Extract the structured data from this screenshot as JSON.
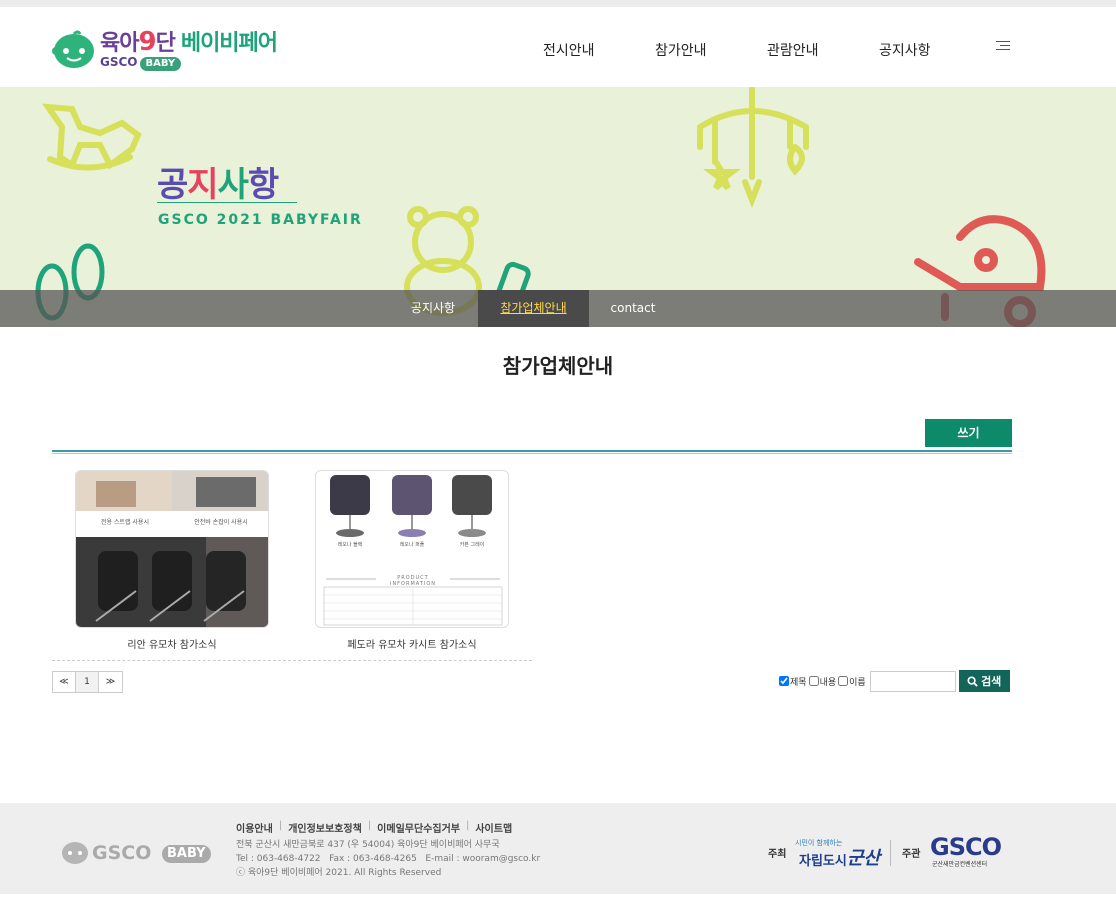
{
  "header": {
    "logo_title_a": "육아",
    "logo_title_9": "9",
    "logo_title_b": "단",
    "logo_title_fair": "베이비페어",
    "logo_sub_gsco": "GSCO",
    "logo_sub_baby": "BABY",
    "nav": [
      "전시안내",
      "참가안내",
      "관람안내",
      "공지사항"
    ]
  },
  "banner": {
    "title_chars": [
      "공",
      "지",
      "사",
      "항"
    ],
    "subtitle": "GSCO 2021 BABYFAIR",
    "subnav": [
      "공지사항",
      "참가업체안내",
      "contact"
    ],
    "active_index": 1
  },
  "content": {
    "heading": "참가업체안내",
    "write_label": "쓰기",
    "posts": [
      {
        "title": "리안 유모차 참가소식",
        "thumb_caption_left": "전용 스트랩 사용시",
        "thumb_caption_right": "안전바 손잡이 사용시"
      },
      {
        "title": "페도라 유모차 카시트 참가소식",
        "thumb_labels": [
          "레오나 블랙",
          "레오나 퍼플",
          "카본 그레이"
        ],
        "thumb_info": "PRODUCT INFORMATION"
      }
    ],
    "pager": {
      "prev": "≪",
      "current": "1",
      "next": "≫"
    },
    "search": {
      "options": [
        {
          "label": "제목",
          "checked": true
        },
        {
          "label": "내용",
          "checked": false
        },
        {
          "label": "이름",
          "checked": false
        }
      ],
      "query": "",
      "button": "검색"
    }
  },
  "footer": {
    "links": [
      "이용안내",
      "개인정보보호정책",
      "이메일무단수집거부",
      "사이트맵"
    ],
    "address": "전북 군산시 새만금북로 437 (우 54004) 육아9단 베이비페어 사무국",
    "contact": "Tel : 063-468-4722   Fax : 063-468-4265   E-mail : wooram@gsco.kr",
    "copyright": "ⓒ 육아9단 베이비페어 2021. All Rights Reserved",
    "logo_gsco": "GSCO",
    "logo_baby": "BABY",
    "host_label": "주최",
    "host_name_small": "시민이 함께하는",
    "host_name_big": "자립도시",
    "host_city": "군산",
    "organizer_label": "주관",
    "organizer_name": "GSCO",
    "organizer_sub": "군산새만금컨벤션센터"
  },
  "colors": {
    "accent_green": "#0d8a6a",
    "banner_bg": "#e9f1d8",
    "rule_teal": "#3b9aa4",
    "active_tab_text": "#ffd84a"
  }
}
